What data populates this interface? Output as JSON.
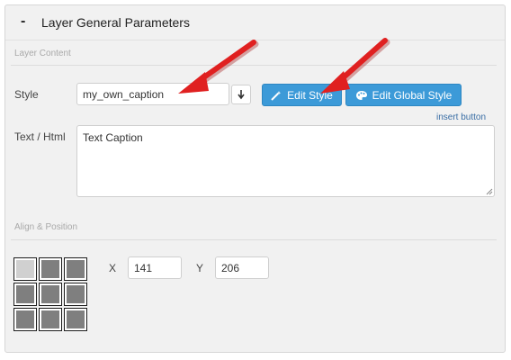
{
  "header": {
    "collapse_symbol": "-",
    "title": "Layer General Parameters"
  },
  "layer_content": {
    "section_label": "Layer Content",
    "style_label": "Style",
    "style_value": "my_own_caption",
    "edit_style_label": "Edit Style",
    "edit_global_style_label": "Edit Global Style",
    "insert_button_label": "insert button",
    "text_label": "Text / Html",
    "text_value": "Text Caption"
  },
  "align_position": {
    "section_label": "Align & Position",
    "x_label": "X",
    "x_value": "141",
    "y_label": "Y",
    "y_value": "206",
    "selected_alignment": "top-left",
    "cells": [
      "top-left",
      "top-center",
      "top-right",
      "middle-left",
      "middle-center",
      "middle-right",
      "bottom-left",
      "bottom-center",
      "bottom-right"
    ]
  },
  "colors": {
    "button_blue": "#3c9ad8",
    "arrow_red": "#e02020",
    "link": "#3a6ea5"
  },
  "icons": {
    "dropdown": "arrow-down-icon",
    "edit_style": "magic-wand-icon",
    "edit_global_style": "palette-icon"
  }
}
